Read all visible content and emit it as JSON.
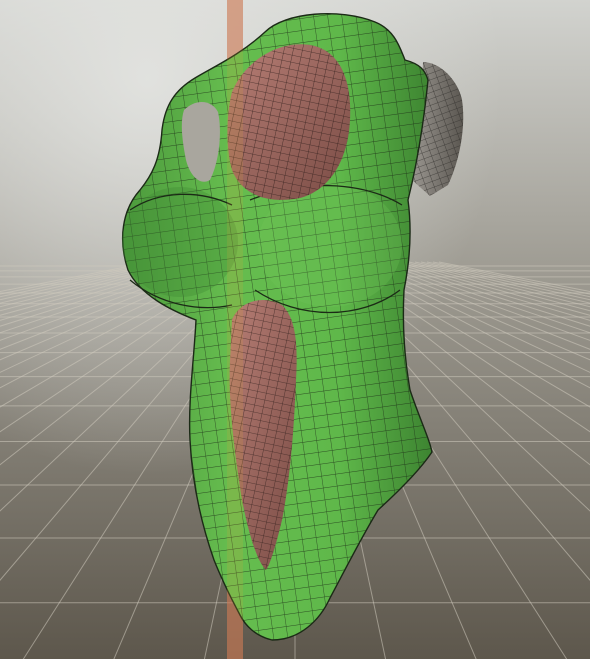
{
  "viewport": {
    "background_top": "#d2d3cf",
    "background_mid": "#8f8c83",
    "background_bottom": "#5d574c",
    "grid_color": "#c9c4b8",
    "mirror_plane_color": "#c86b5e"
  },
  "mesh": {
    "material_color": "#5fb84a",
    "material_shadow": "#3f8a35",
    "wire_color": "#1b2a16",
    "interior_color": "#a87068",
    "interior_shadow": "#6e4640"
  }
}
